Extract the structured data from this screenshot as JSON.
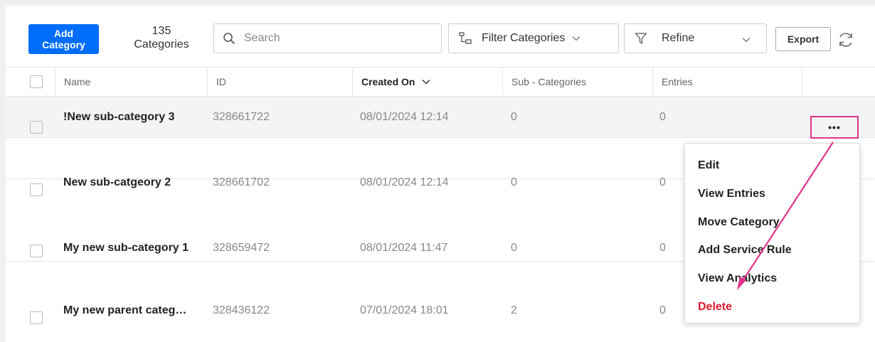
{
  "toolbar": {
    "add_button": {
      "line1": "Add",
      "line2": "Category"
    },
    "count": {
      "number": "135",
      "label": "Categories"
    },
    "search_placeholder": "Search",
    "filter_label": "Filter Categories",
    "refine_label": "Refine",
    "export_label": "Export"
  },
  "table": {
    "columns": [
      "Name",
      "ID",
      "Created On",
      "Sub - Categories",
      "Entries"
    ],
    "rows": [
      {
        "name": "!New sub-category 3",
        "id": "328661722",
        "created_on": "08/01/2024 12:14",
        "sub_categories": "0",
        "entries": "0"
      },
      {
        "name": "New sub-catgeory 2",
        "id": "328661702",
        "created_on": "08/01/2024 12:14",
        "sub_categories": "0",
        "entries": "0"
      },
      {
        "name": "My new sub-category 1",
        "id": "328659472",
        "created_on": "08/01/2024 11:47",
        "sub_categories": "0",
        "entries": "0"
      },
      {
        "name": "My new parent categ…",
        "id": "328436122",
        "created_on": "07/01/2024 18:01",
        "sub_categories": "2",
        "entries": "0"
      }
    ]
  },
  "more_button_label": "•••",
  "context_menu": {
    "items": [
      "Edit",
      "View Entries",
      "Move Category",
      "Add Service Rule",
      "View Analytics",
      "Delete"
    ]
  },
  "colors": {
    "primary": "#006efa",
    "annotation": "#e0338a",
    "danger": "#e0182d"
  }
}
